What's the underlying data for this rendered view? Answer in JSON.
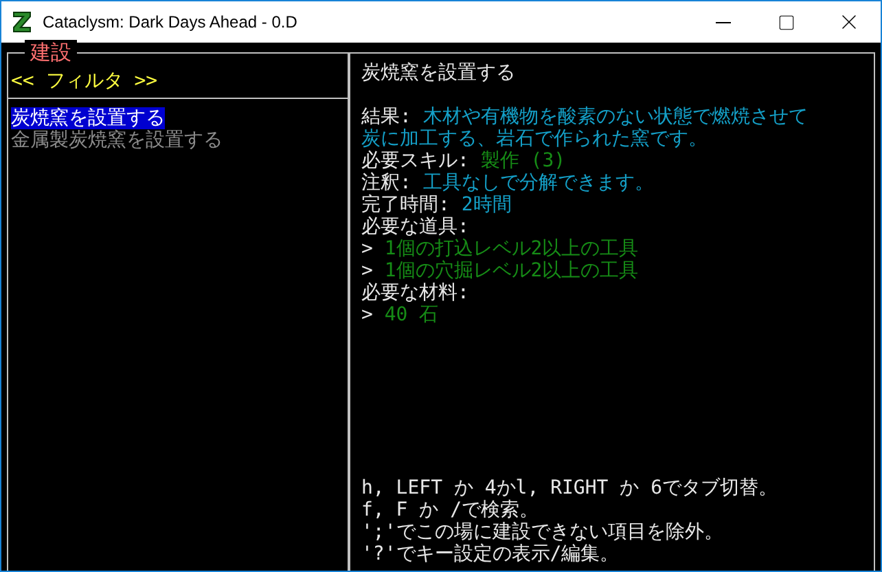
{
  "window": {
    "title": "Cataclysm: Dark Days Ahead - 0.D"
  },
  "panel": {
    "title": "建設",
    "filter": "<< フィルタ >>",
    "items": [
      {
        "label": "炭焼窯を設置する",
        "selected": true,
        "disabled": false
      },
      {
        "label": "金属製炭焼窯を設置する",
        "selected": false,
        "disabled": true
      }
    ]
  },
  "detail": {
    "title": "炭焼窯を設置する",
    "lines": [
      {
        "kind": "field",
        "label": "結果:",
        "value": "木材や有機物を酸素のない状態で燃焼させて",
        "color": "#14a0c8"
      },
      {
        "kind": "continuation",
        "value": "炭に加工する、岩石で作られた窯です。",
        "color": "#14a0c8"
      },
      {
        "kind": "field",
        "label": "必要スキル:",
        "value": "製作 (3)",
        "color": "#168c16"
      },
      {
        "kind": "field",
        "label": "注釈:",
        "value": "工具なしで分解できます。",
        "color": "#14a0c8"
      },
      {
        "kind": "field",
        "label": "完了時間:",
        "value": "2時間",
        "color": "#14a0c8"
      },
      {
        "kind": "heading",
        "label": "必要な道具:"
      },
      {
        "kind": "entry",
        "marker": ">",
        "value": "1個の打込レベル2以上の工具",
        "color": "#168c16"
      },
      {
        "kind": "entry",
        "marker": ">",
        "value": "1個の穴掘レベル2以上の工具",
        "color": "#168c16"
      },
      {
        "kind": "heading",
        "label": "必要な材料:"
      },
      {
        "kind": "entry",
        "marker": ">",
        "value": "40 石",
        "color": "#168c16"
      }
    ],
    "help": [
      "h, LEFT か 4かl, RIGHT か 6でタブ切替。",
      "f, F か /で検索。",
      "';'でこの場に建設できない項目を除外。",
      "'?'でキー設定の表示/編集。"
    ]
  }
}
